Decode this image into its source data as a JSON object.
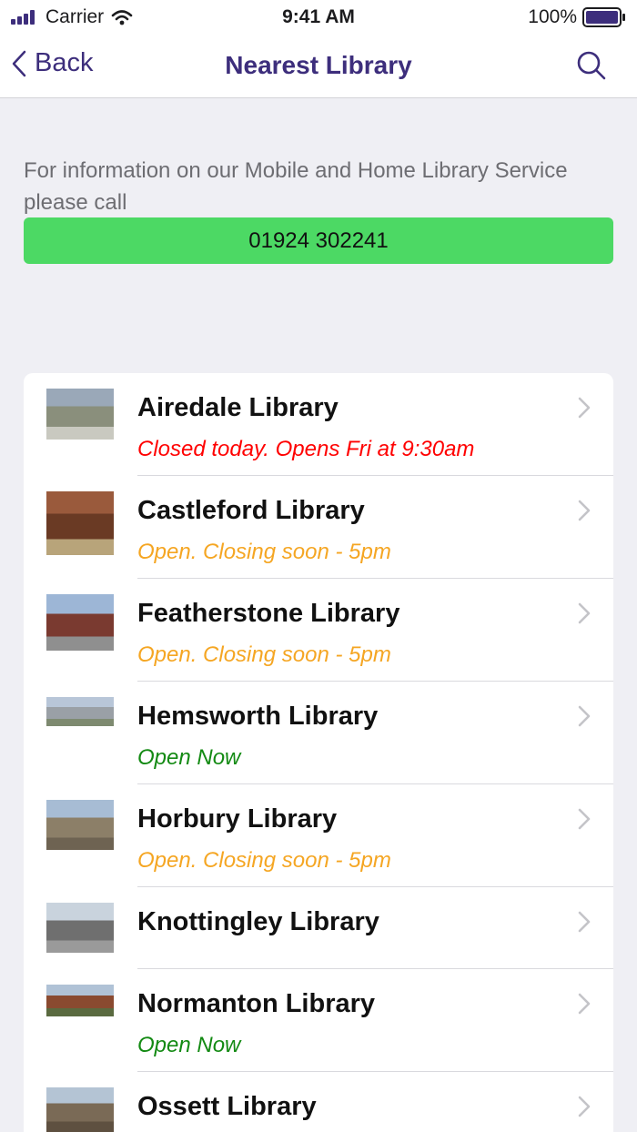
{
  "status_bar": {
    "carrier": "Carrier",
    "time": "9:41 AM",
    "battery": "100%"
  },
  "nav": {
    "back_label": "Back",
    "title": "Nearest Library",
    "accent_color": "#3d2e7c"
  },
  "info": {
    "text": "For information on our Mobile and Home Library Service please call",
    "phone": "01924 302241",
    "phone_button_color": "#4cd964"
  },
  "status_colors": {
    "closed": "#ff0000",
    "closing_soon": "#f5a623",
    "open": "#138a13"
  },
  "libraries": [
    {
      "name": "Airedale Library",
      "status": "Closed today. Opens Fri at 9:30am",
      "status_type": "closed"
    },
    {
      "name": "Castleford Library",
      "status": "Open. Closing soon - 5pm",
      "status_type": "closing_soon"
    },
    {
      "name": "Featherstone Library",
      "status": "Open. Closing soon - 5pm",
      "status_type": "closing_soon"
    },
    {
      "name": "Hemsworth Library",
      "status": "Open Now",
      "status_type": "open"
    },
    {
      "name": "Horbury Library",
      "status": "Open. Closing soon - 5pm",
      "status_type": "closing_soon"
    },
    {
      "name": "Knottingley Library",
      "status": "",
      "status_type": "none"
    },
    {
      "name": "Normanton Library",
      "status": "Open Now",
      "status_type": "open"
    },
    {
      "name": "Ossett Library",
      "status": "",
      "status_type": "none"
    }
  ]
}
